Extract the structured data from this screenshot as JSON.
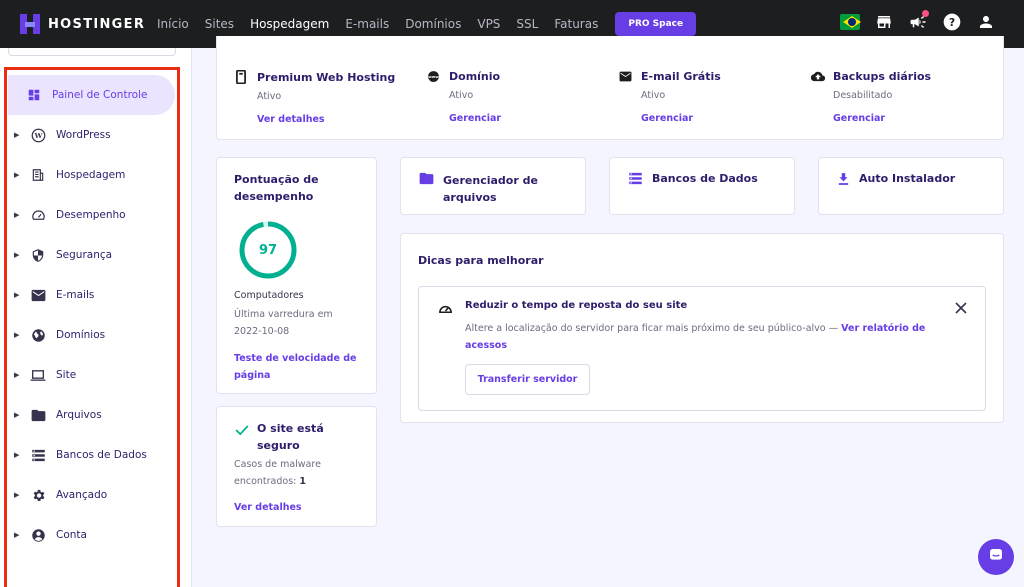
{
  "brand": {
    "name": "HOSTINGER"
  },
  "nav": {
    "items": [
      "Início",
      "Sites",
      "Hospedagem",
      "E-mails",
      "Domínios",
      "VPS",
      "SSL",
      "Faturas"
    ],
    "active": "Hospedagem",
    "pro_button": "PRO Space"
  },
  "sidebar": {
    "items": [
      {
        "label": "Painel de Controle",
        "icon": "dashboard-icon"
      },
      {
        "label": "WordPress",
        "icon": "wordpress-icon"
      },
      {
        "label": "Hospedagem",
        "icon": "hosting-icon"
      },
      {
        "label": "Desempenho",
        "icon": "speedometer-icon"
      },
      {
        "label": "Segurança",
        "icon": "shield-icon"
      },
      {
        "label": "E-mails",
        "icon": "mail-icon"
      },
      {
        "label": "Domínios",
        "icon": "globe-icon"
      },
      {
        "label": "Site",
        "icon": "laptop-icon"
      },
      {
        "label": "Arquivos",
        "icon": "folder-icon"
      },
      {
        "label": "Bancos de Dados",
        "icon": "database-icon"
      },
      {
        "label": "Avançado",
        "icon": "gear-icon"
      },
      {
        "label": "Conta",
        "icon": "account-icon"
      }
    ]
  },
  "services": [
    {
      "title": "Premium Web Hosting",
      "status": "Ativo",
      "link": "Ver detalhes",
      "icon": "server-icon"
    },
    {
      "title": "Domínio",
      "status": "Ativo",
      "link": "Gerenciar",
      "icon": "www-icon"
    },
    {
      "title": "E-mail Grátis",
      "status": "Ativo",
      "link": "Gerenciar",
      "icon": "mail-icon"
    },
    {
      "title": "Backups diários",
      "status": "Desabilitado",
      "link": "Gerenciar",
      "icon": "cloud-upload-icon"
    }
  ],
  "performance": {
    "title_line1": "Pontuação de",
    "title_line2": "desempenho",
    "score": "97",
    "score_fraction": 0.97,
    "device": "Computadores",
    "scan_line1": "Última varredura em",
    "scan_line2": "2022-10-08",
    "link_line1": "Teste de velocidade de",
    "link_line2": "página"
  },
  "security": {
    "title_line1": "O site está",
    "title_line2": "seguro",
    "malware_line1": "Casos de malware",
    "malware_line2": "encontrados:",
    "malware_count": "1",
    "link": "Ver detalhes"
  },
  "tools": [
    {
      "label_line1": "Gerenciador de",
      "label_line2": "arquivos",
      "icon": "folder-icon"
    },
    {
      "label_line1": "Bancos de Dados",
      "label_line2": "",
      "icon": "database-icon"
    },
    {
      "label_line1": "Auto Instalador",
      "label_line2": "",
      "icon": "download-icon"
    }
  ],
  "tips": {
    "title": "Dicas para melhorar",
    "item_title": "Reduzir o tempo de reposta do seu site",
    "item_desc": "Altere a localização do servidor para ficar mais próximo de seu público-alvo —",
    "item_link_line1": "Ver relatório de",
    "item_link_line2": "acessos",
    "button": "Transferir servidor"
  },
  "colors": {
    "accent": "#673de6",
    "topbar": "#1d1e20",
    "score_green": "#00b090",
    "highlight_red": "#ea2c14"
  }
}
